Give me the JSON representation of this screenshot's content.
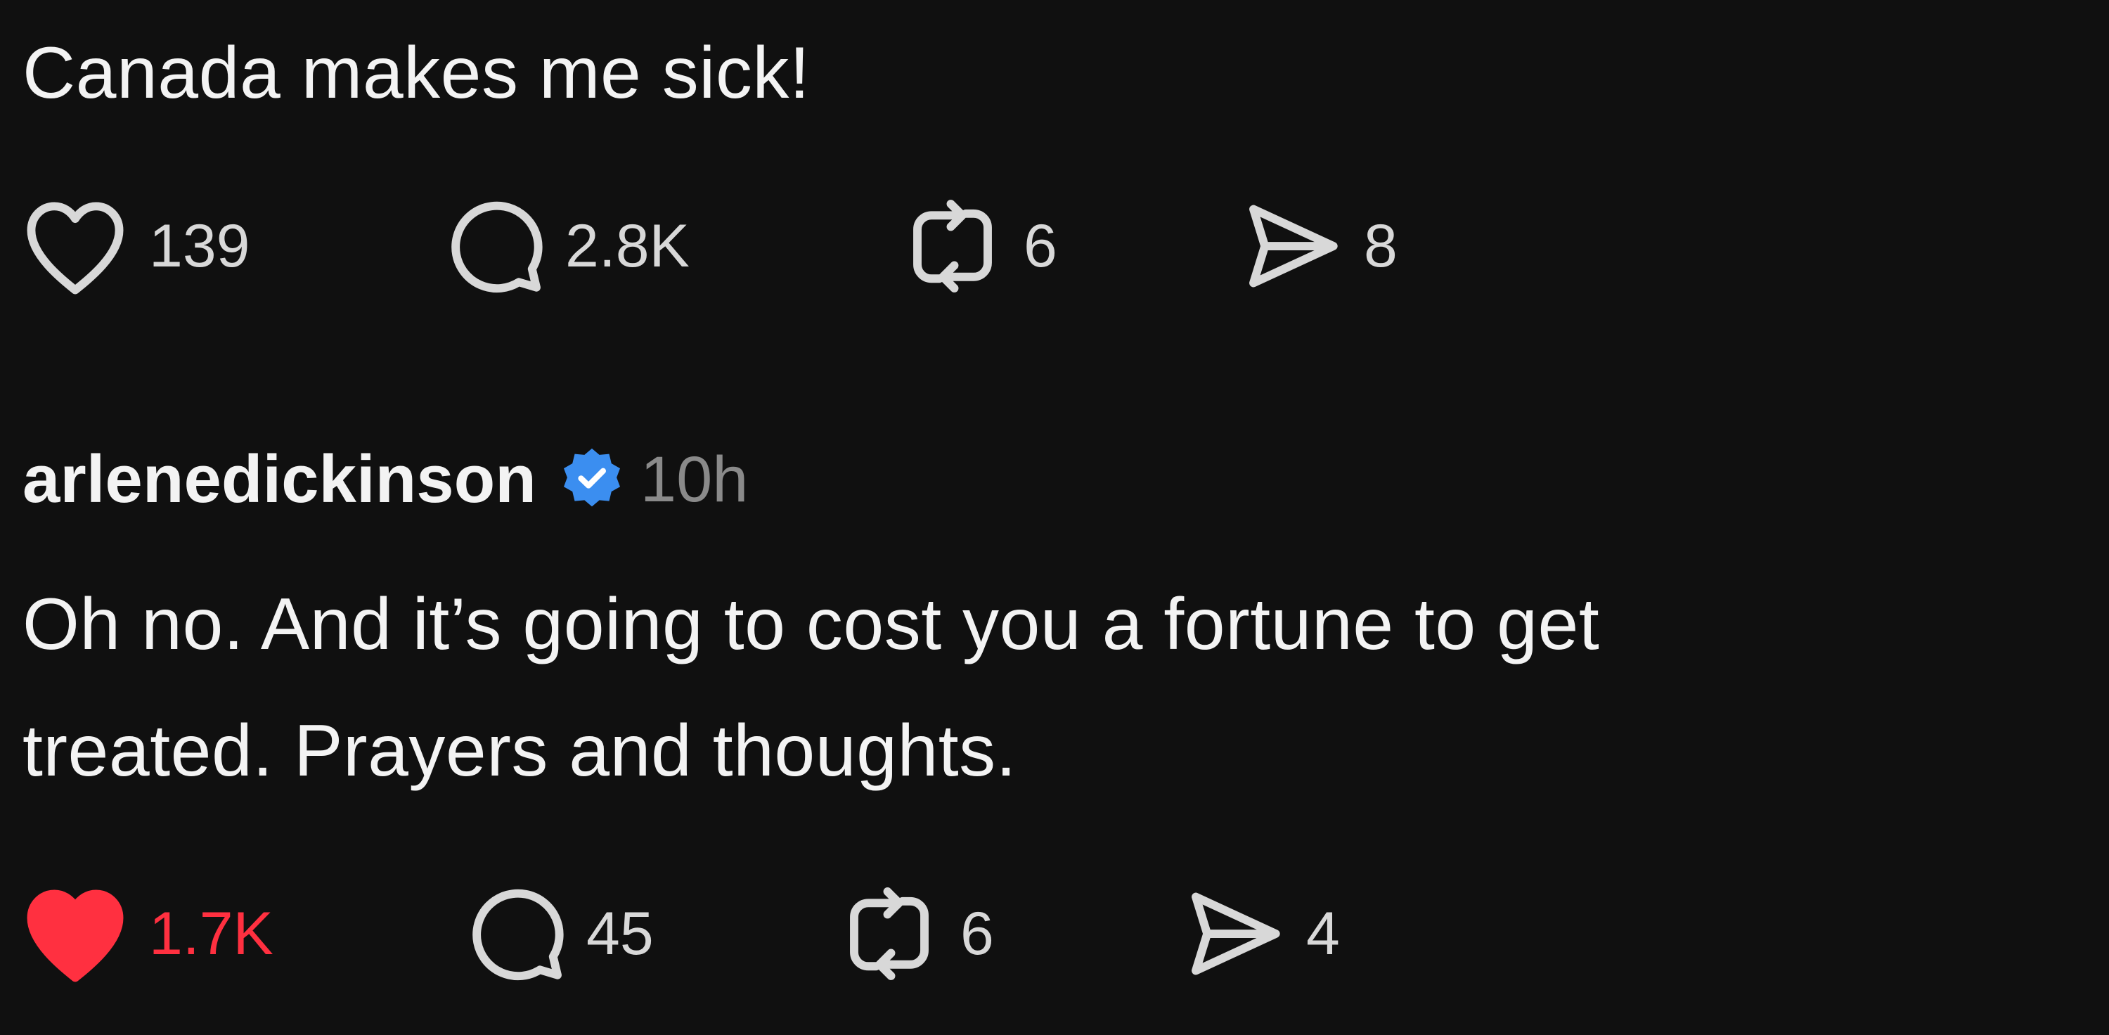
{
  "post": {
    "text": "Canada makes me sick!",
    "likes": "139",
    "replies": "2.8K",
    "reposts": "6",
    "shares": "8"
  },
  "reply": {
    "username": "arlenedickinson",
    "verified_icon": "verified-badge-icon",
    "time": "10h",
    "text_line1": "Oh no. And it’s going to cost you a fortune to get",
    "text_line2": "treated. Prayers and thoughts.",
    "likes": "1.7K",
    "liked": true,
    "replies": "45",
    "reposts": "6",
    "shares": "4"
  },
  "colors": {
    "background": "#101010",
    "text": "#f3f3f3",
    "muted": "#8a8a8a",
    "like_active": "#ff3040",
    "verified": "#3b8ef0"
  }
}
